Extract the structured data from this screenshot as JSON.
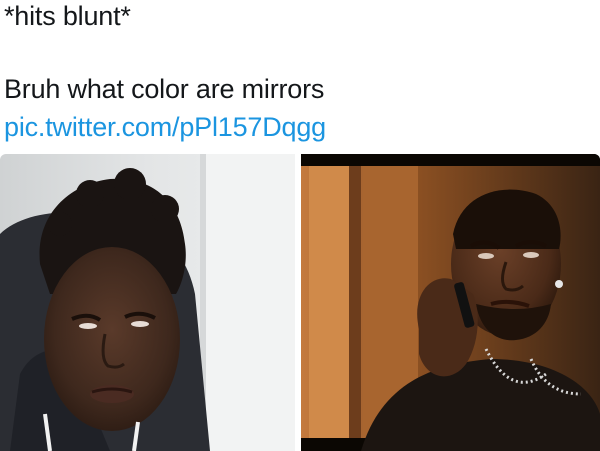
{
  "tweet": {
    "line1": "*hits blunt*",
    "line2": "Bruh what color are mirrors",
    "link": "pic.twitter.com/pPl157Dqgg"
  },
  "colors": {
    "text": "#14171a",
    "link": "#1b95e0",
    "background": "#ffffff"
  },
  "media": {
    "left_photo": "man-in-hoodie-squinting-photo",
    "right_photo": "man-on-phone-crying-photo"
  }
}
